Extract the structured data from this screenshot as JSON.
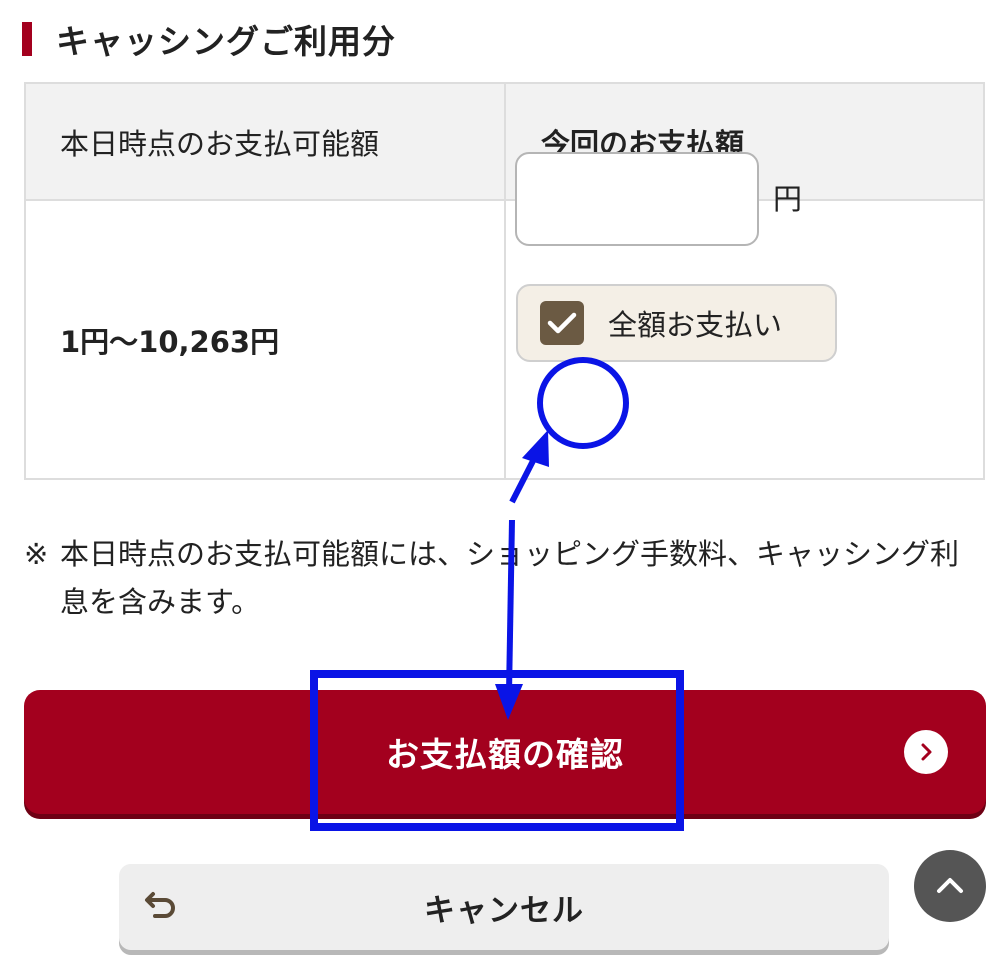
{
  "section": {
    "title": "キャッシングご利用分"
  },
  "table": {
    "header_available": "本日時点のお支払可能額",
    "header_payment": "今回のお支払額",
    "available_range": "1円〜10,263円",
    "amount_input_value": "",
    "unit": "円",
    "full_payment_label": "全額お支払い",
    "full_payment_checked": true
  },
  "note": {
    "mark": "※",
    "text": "本日時点のお支払可能額には、ショッピング手数料、キャッシング利息を含みます。"
  },
  "buttons": {
    "confirm_label": "お支払額の確認",
    "cancel_label": "キャンセル"
  },
  "icons": {
    "confirm_arrow": "chevron-right-circle-icon",
    "cancel": "return-arrow-icon",
    "page_top": "chevron-up-icon",
    "checkbox": "checkmark-icon"
  },
  "colors": {
    "brand": "#a3001e",
    "checkbox": "#6b5a43",
    "annotation": "#0a14e6"
  }
}
